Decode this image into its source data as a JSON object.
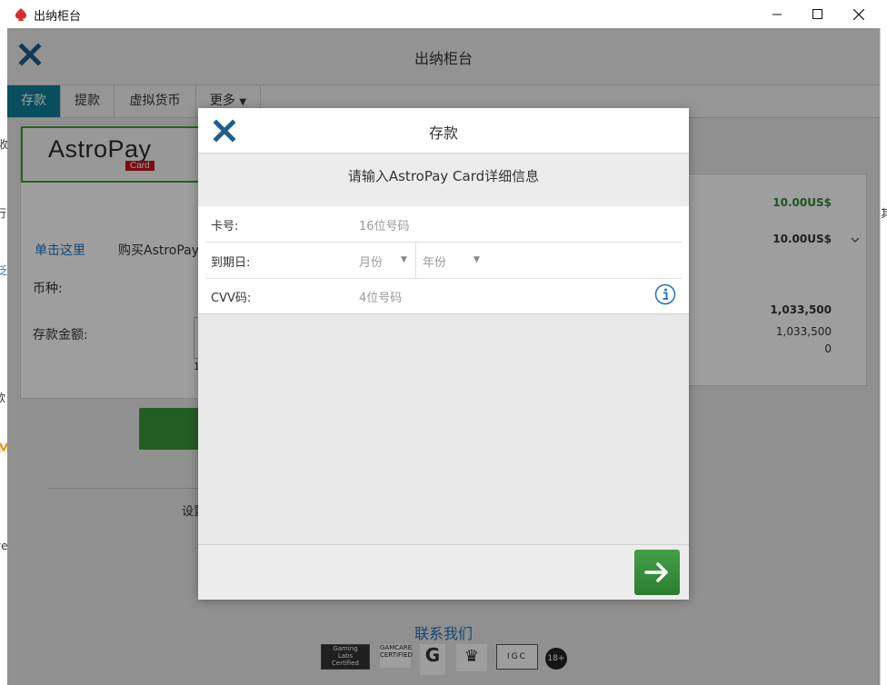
{
  "window": {
    "title": "出纳柜台",
    "controls": [
      "minimize",
      "maximize",
      "close"
    ]
  },
  "app": {
    "header_title": "出纳柜台",
    "tabs": [
      {
        "label": "存款",
        "active": true
      },
      {
        "label": "提款",
        "active": false
      },
      {
        "label": "虚拟货币",
        "active": false
      },
      {
        "label": "更多",
        "active": false,
        "dropdown": true
      }
    ],
    "method": {
      "logo_text": "AstroPay",
      "logo_sub": "Card"
    },
    "buy_link": "单击这里",
    "buy_rest": "购买AstroPay卡。",
    "currency_label": "币种:",
    "amount_label": "存款金额:",
    "amount_hint": "1",
    "setting_text": "设置",
    "right_values": {
      "min": "10.00US$",
      "selected": "10.00US$",
      "balance_total": "1,033,500",
      "balance_a": "1,033,500",
      "balance_b": "0"
    },
    "contact": "联系我们",
    "cert_logos": [
      "Gaming Labs Certified",
      "GAMCARE CERTIFIED",
      "GAMCARE",
      "crest",
      "IGC",
      "18+"
    ]
  },
  "modal": {
    "title": "存款",
    "subtitle": "请输入AstroPay Card详细信息",
    "card_label": "卡号:",
    "card_placeholder": "16位号码",
    "expiry_label": "到期日:",
    "month_placeholder": "月份",
    "year_placeholder": "年份",
    "cvv_label": "CVV码:",
    "cvv_placeholder": "4位号码"
  },
  "colors": {
    "tab_active": "#0e7f98",
    "close_x": "#1f5f8f",
    "next_button": "#3a963a",
    "link": "#1b72c2"
  },
  "edge_fragments": {
    "left": [
      "收",
      "行",
      "泛",
      "款",
      "M",
      "ye"
    ],
    "right": [
      "其"
    ]
  }
}
